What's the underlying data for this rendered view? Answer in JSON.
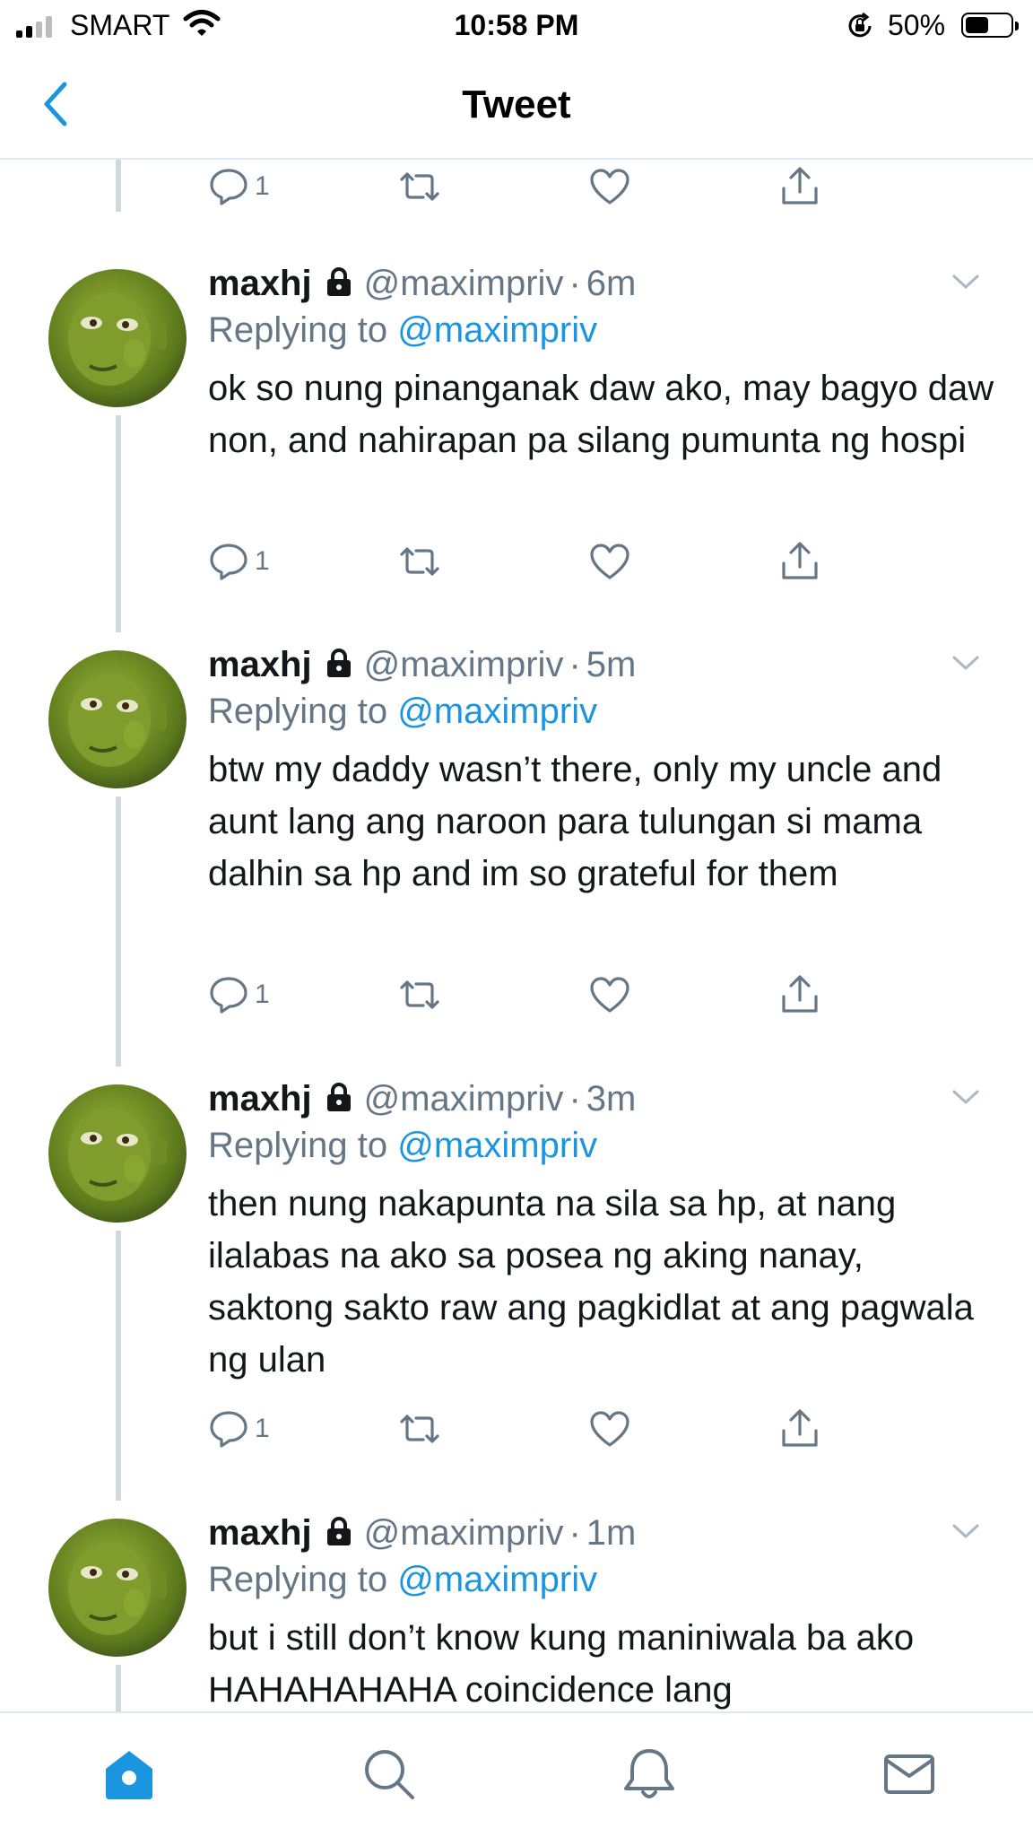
{
  "status_bar": {
    "carrier": "SMART",
    "time": "10:58 PM",
    "battery_text": "50%",
    "battery_level": 0.5
  },
  "nav": {
    "title": "Tweet",
    "back_icon": "chevron-left-icon"
  },
  "top_actions": {
    "reply_count": "1"
  },
  "tweets": [
    {
      "name": "maxhj",
      "handle": "@maximpriv",
      "dot": "·",
      "time": "6m",
      "replying_prefix": "Replying to",
      "replying_to": "@maximpriv",
      "text": "ok so nung pinanganak daw ako, may bagyo daw non, and nahirapan pa silang pumunta ng hospi",
      "reply_count": "1"
    },
    {
      "name": "maxhj",
      "handle": "@maximpriv",
      "dot": "·",
      "time": "5m",
      "replying_prefix": "Replying to",
      "replying_to": "@maximpriv",
      "text": "btw my daddy wasn’t there, only my uncle and aunt lang ang naroon para tulungan si mama dalhin sa hp and im so grateful for them",
      "reply_count": "1"
    },
    {
      "name": "maxhj",
      "handle": "@maximpriv",
      "dot": "·",
      "time": "3m",
      "replying_prefix": "Replying to",
      "replying_to": "@maximpriv",
      "text": "then nung nakapunta na sila sa hp, at nang ilalabas na ako sa posea ng aking nanay, saktong sakto raw ang pagkidlat at ang pagwala ng ulan",
      "reply_count": "1"
    },
    {
      "name": "maxhj",
      "handle": "@maximpriv",
      "dot": "·",
      "time": "1m",
      "replying_prefix": "Replying to",
      "replying_to": "@maximpriv",
      "text": "but i still don’t know kung maniniwala ba ako HAHAHAHAHA coincidence lang",
      "reply_count": ""
    }
  ],
  "tab_bar": {
    "tabs": [
      "home-icon",
      "search-icon",
      "notifications-icon",
      "messages-icon"
    ],
    "active": "home-icon"
  },
  "colors": {
    "accent": "#1b95e0",
    "secondary_text": "#657786",
    "thread_line": "#cfd9de",
    "divider": "#e1e8ed",
    "avatar_green": "#7a9a2a"
  }
}
